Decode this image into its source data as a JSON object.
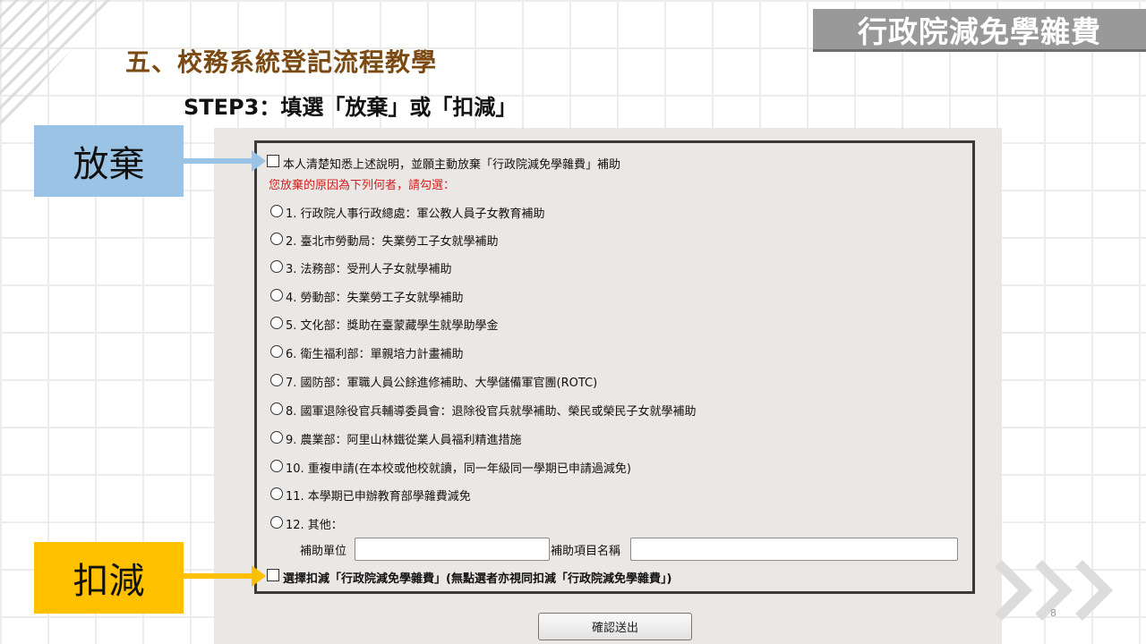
{
  "brand": "行政院減免學雜費",
  "title": "五、校務系統登記流程教學",
  "step": "STEP3：填選「放棄」或「扣減」",
  "callouts": {
    "abandon": "放棄",
    "deduct": "扣減",
    "abandon_color": "#9bc3e6",
    "deduct_color": "#ffc000"
  },
  "form": {
    "abandon_checkbox_label": "本人清楚知悉上述說明，並願主動放棄「行政院減免學雜費」補助",
    "reason_prompt": "您放棄的原因為下列何者，請勾選：",
    "reasons": [
      "1. 行政院人事行政總處：軍公教人員子女教育補助",
      "2. 臺北市勞動局：失業勞工子女就學補助",
      "3. 法務部：受刑人子女就學補助",
      "4. 勞動部：失業勞工子女就學補助",
      "5. 文化部：獎助在臺蒙藏學生就學助學金",
      "6. 衛生福利部：單親培力計畫補助",
      "7. 國防部：軍職人員公餘進修補助、大學儲備軍官團(ROTC)",
      "8. 國軍退除役官兵輔導委員會：退除役官兵就學補助、榮民或榮民子女就學補助",
      "9. 農業部：阿里山林鐵從業人員福利精進措施",
      "10. 重複申請(在本校或他校就讀，同一年級同一學期已申請過減免)",
      "11. 本學期已申辦教育部學雜費減免",
      "12. 其他："
    ],
    "subsidy_unit_label": "補助單位",
    "subsidy_item_label": "補助項目名稱",
    "subsidy_unit_value": "",
    "subsidy_item_value": "",
    "deduct_checkbox_label": "選擇扣減「行政院減免學雜費」(無點選者亦視同扣減「行政院減免學雜費」)",
    "submit_label": "確認送出"
  },
  "page_number": "8"
}
